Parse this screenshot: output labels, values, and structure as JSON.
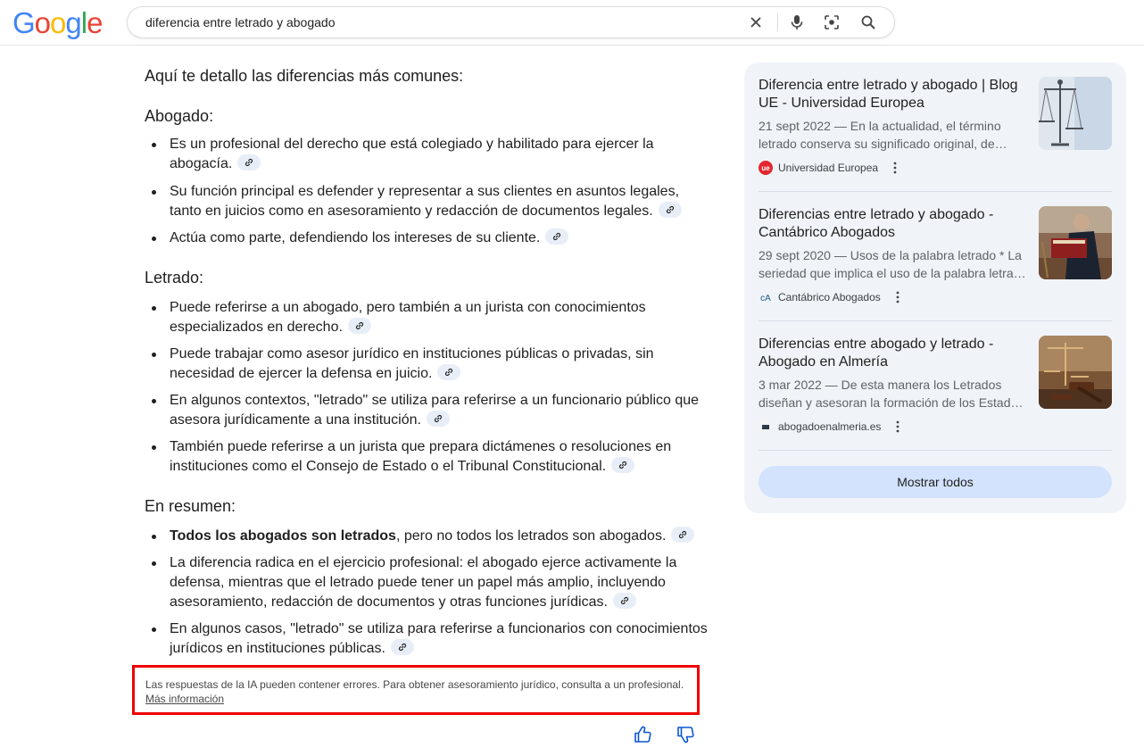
{
  "search": {
    "query": "diferencia entre letrado y abogado"
  },
  "logo": {
    "text": "Google"
  },
  "answer": {
    "intro": "Aquí te detallo las diferencias más comunes:",
    "sections": [
      {
        "heading": "Abogado:",
        "items": [
          {
            "text": "Es un profesional del derecho que está colegiado y habilitado para ejercer la abogacía."
          },
          {
            "text": "Su función principal es defender y representar a sus clientes en asuntos legales, tanto en juicios como en asesoramiento y redacción de documentos legales."
          },
          {
            "text": "Actúa como parte, defendiendo los intereses de su cliente."
          }
        ]
      },
      {
        "heading": "Letrado:",
        "items": [
          {
            "text": "Puede referirse a un abogado, pero también a un jurista con conocimientos especializados en derecho."
          },
          {
            "text": "Puede trabajar como asesor jurídico en instituciones públicas o privadas, sin necesidad de ejercer la defensa en juicio."
          },
          {
            "text": "En algunos contextos, \"letrado\" se utiliza para referirse a un funcionario público que asesora jurídicamente a una institución."
          },
          {
            "text": "También puede referirse a un jurista que prepara dictámenes o resoluciones en instituciones como el Consejo de Estado o el Tribunal Constitucional."
          }
        ]
      },
      {
        "heading": "En resumen:",
        "items": [
          {
            "bold": "Todos los abogados son letrados",
            "text": ", pero no todos los letrados son abogados."
          },
          {
            "text": "La diferencia radica en el ejercicio profesional: el abogado ejerce activamente la defensa, mientras que el letrado puede tener un papel más amplio, incluyendo asesoramiento, redacción de documentos y otras funciones jurídicas."
          },
          {
            "text": "En algunos casos, \"letrado\" se utiliza para referirse a funcionarios con conocimientos jurídicos en instituciones públicas."
          }
        ]
      }
    ],
    "disclaimer": "Las respuestas de la IA pueden contener errores. Para obtener asesoramiento jurídico, consulta a un profesional.",
    "more_info": "Más información"
  },
  "sources": {
    "cards": [
      {
        "title": "Diferencia entre letrado y abogado | Blog UE - Universidad Europea",
        "snippet": "21 sept 2022 — En la actualidad, el término letrado conserva su significado original, de…",
        "source": "Universidad Europea",
        "favicon": "ue"
      },
      {
        "title": "Diferencias entre letrado y abogado - Cantábrico Abogados",
        "snippet": "29 sept 2020 — Usos de la palabra letrado * La seriedad que implica el uso de la palabra letra…",
        "source": "Cantábrico Abogados",
        "favicon": "cA"
      },
      {
        "title": "Diferencias entre abogado y letrado - Abogado en Almería",
        "snippet": "3 mar 2022 — De esta manera los Letrados diseñan y asesoran la formación de los Estad…",
        "source": "abogadoenalmeria.es",
        "favicon": ""
      }
    ],
    "show_all": "Mostrar todos"
  },
  "colors": {
    "google_blue": "#4285F4",
    "google_red": "#EA4335",
    "google_yellow": "#FBBC05",
    "google_green": "#34A853",
    "highlight_border": "#ee0000",
    "panel_bg": "#f0f4f9",
    "show_all_bg": "#d3e3fd"
  }
}
